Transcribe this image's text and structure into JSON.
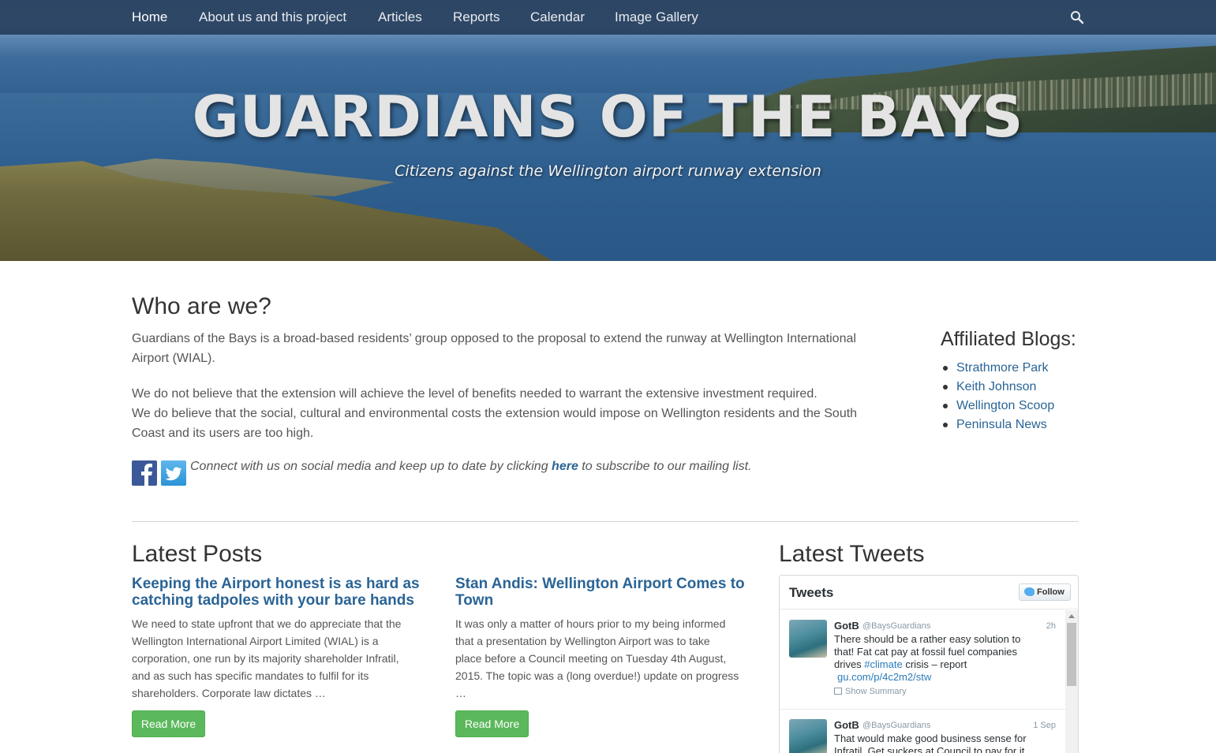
{
  "nav": {
    "items": [
      {
        "label": "Home",
        "active": true
      },
      {
        "label": "About us and this project"
      },
      {
        "label": "Articles"
      },
      {
        "label": "Reports"
      },
      {
        "label": "Calendar"
      },
      {
        "label": "Image Gallery"
      }
    ],
    "search_icon": "search-icon"
  },
  "hero": {
    "title": "GUARDIANS OF THE BAYS",
    "subtitle": "Citizens against the Wellington airport runway extension"
  },
  "about": {
    "heading": "Who are we?",
    "para1_line1": "Guardians of the Bays is a broad-based residents’ group opposed to the proposal to extend the runway at Wellington International",
    "para1_line2": "Airport (WIAL).",
    "para2_line1": "We do not believe that the extension will achieve the level of benefits needed to warrant the extensive investment required.",
    "para2_line2": "We do believe that the social, cultural and environmental costs the extension would impose on Wellington residents and the South",
    "para2_line3": "Coast and its users are too high.",
    "connect_before": "Connect with us on social media and keep up to date by clicking ",
    "connect_link": "here",
    "connect_after": " to subscribe to our mailing list.",
    "social_icons": [
      "facebook-icon",
      "twitter-icon"
    ]
  },
  "sidebar": {
    "title": "Affiliated Blogs:",
    "blogs": [
      "Strathmore Park",
      "Keith Johnson",
      "Wellington Scoop",
      "Peninsula News"
    ]
  },
  "posts": {
    "heading": "Latest Posts",
    "items": [
      {
        "title_line1": "Keeping the Airport honest is as hard as",
        "title_line2": "catching tadpoles with your bare hands",
        "excerpt": [
          "We need to state upfront that we do appreciate that the",
          "Wellington International Airport Limited (WIAL) is a",
          "corporation, one run by its majority shareholder Infratil,",
          "and as such has specific mandates to fulfil for its",
          "shareholders. Corporate law dictates …"
        ],
        "button": "Read More"
      },
      {
        "title_line1": "Stan Andis: Wellington Airport Comes to",
        "title_line2": "Town",
        "excerpt": [
          "It was only a matter of hours prior to my being informed",
          "that a presentation by Wellington Airport was to take",
          "place before a Council meeting on Tuesday 4th August,",
          "2015. The topic was a (long overdue!) update on progress",
          "…"
        ],
        "button": "Read More"
      }
    ]
  },
  "tweets": {
    "heading": "Latest Tweets",
    "widget_title": "Tweets",
    "follow_label": "Follow",
    "items": [
      {
        "name": "GotB",
        "handle": "@BaysGuardians",
        "time": "2h",
        "text_l1": "There should be a rather easy solution to",
        "text_l2": "that! Fat cat pay at fossil fuel companies",
        "text_l3_pre": "drives ",
        "hashtag": "#climate",
        "text_l3_post": " crisis – report",
        "url": "gu.com/p/4c2m2/stw",
        "summary": "Show Summary"
      },
      {
        "name": "GotB",
        "handle": "@BaysGuardians",
        "time": "1 Sep",
        "text_l1": "That would make good business sense for",
        "text_l2": "Infratil. Get suckers at Council to pay for it"
      }
    ]
  }
}
